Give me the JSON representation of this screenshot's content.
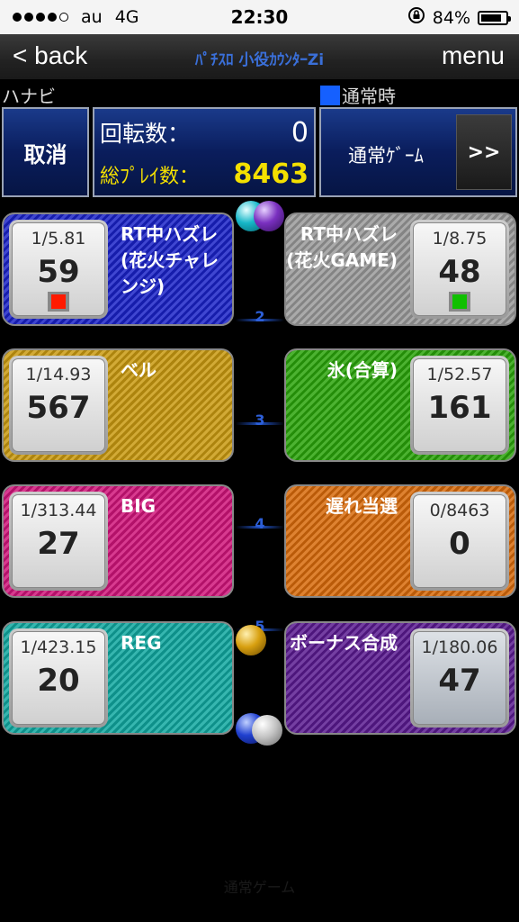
{
  "status": {
    "carrier": "au",
    "network": "4G",
    "time": "22:30",
    "battery": "84%",
    "battery_level": 0.84
  },
  "nav": {
    "back_label": "< back",
    "title": "ﾊﾟﾁｽﾛ 小役ｶｳﾝﾀｰZi",
    "menu_label": "menu"
  },
  "machine_name": "ハナビ",
  "mode_label": "通常時",
  "cancel_label": "取消",
  "counters": {
    "spin_label": "回転数：",
    "spin_value": "0",
    "total_label": "総ﾌﾟﾚｲ数：",
    "total_value": "8463"
  },
  "normal_game_label": "通常ｹﾞｰﾑ",
  "next_button": ">>",
  "cards": [
    {
      "label": "RT中ハズレ(花火チャレンジ)",
      "ratio": "1/5.81",
      "count": "59",
      "color": "#1a22c8",
      "indicator": "#ff1a00"
    },
    {
      "label": "RT中ハズレ(花火GAME)",
      "ratio": "1/8.75",
      "count": "48",
      "color": "#9a9a9a",
      "indicator": "#10c000"
    },
    {
      "label": "ベル",
      "ratio": "1/14.93",
      "count": "567",
      "color": "#c99a10"
    },
    {
      "label": "氷(合算)",
      "ratio": "1/52.57",
      "count": "161",
      "color": "#2aa40a"
    },
    {
      "label": "BIG",
      "ratio": "1/313.44",
      "count": "27",
      "color": "#d0147a"
    },
    {
      "label": "遅れ当選",
      "ratio": "0/8463",
      "count": "0",
      "color": "#d86a0a"
    },
    {
      "label": "REG",
      "ratio": "1/423.15",
      "count": "20",
      "color": "#10a8a0"
    },
    {
      "label": "ボーナス合成",
      "ratio": "1/180.06",
      "count": "47",
      "color": "#5a1a90"
    }
  ],
  "separators": [
    "2",
    "3",
    "4",
    "5"
  ],
  "footer": "通常ゲーム"
}
